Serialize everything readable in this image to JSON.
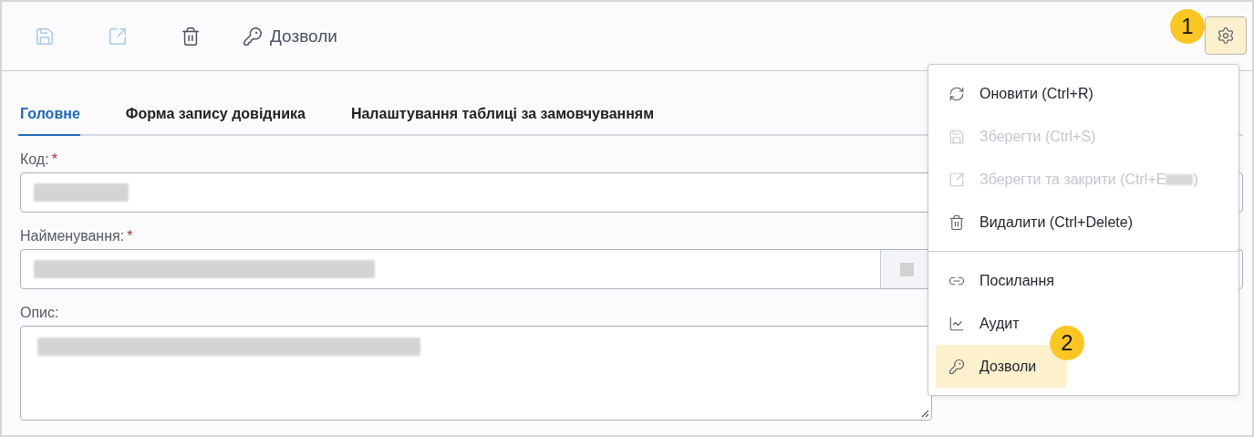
{
  "toolbar": {
    "buttons": [
      {
        "disabled": true
      },
      {
        "disabled": true
      },
      {
        "disabled": false
      },
      {
        "label": "Дозволи",
        "disabled": false
      }
    ],
    "settings": {
      "active": true,
      "callout": "1"
    }
  },
  "tabs": [
    {
      "label": "Головне",
      "selected": true
    },
    {
      "label": "Форма запису довідника",
      "selected": false
    },
    {
      "label": "Налаштування таблиці за замовчуванням",
      "selected": false
    }
  ],
  "fields": [
    {
      "kind": "input",
      "label": "Код:",
      "mark": "*",
      "redacted": true
    },
    {
      "kind": "input-addon",
      "label": "Найменування:",
      "mark": "*",
      "redacted": true
    },
    {
      "kind": "textarea",
      "label": "Опис:",
      "redacted": true
    }
  ],
  "menu": {
    "groups": [
      [
        {
          "label": "Оновити (Ctrl+R)",
          "disabled": false,
          "selected": false
        },
        {
          "label": "Зберегти (Ctrl+S)",
          "disabled": true,
          "selected": false
        },
        {
          "label": "Зберегти та закрити (Ctrl+E",
          "label_end": ")",
          "disabled": true,
          "selected": false
        },
        {
          "label": "Видалити (Ctrl+Delete)",
          "disabled": false,
          "selected": false
        }
      ],
      [
        {
          "label": "Посилання",
          "disabled": false,
          "selected": false
        },
        {
          "label": "Аудит",
          "disabled": false,
          "selected": false
        },
        {
          "label": "Дозволи",
          "disabled": false,
          "selected": true,
          "callout": "2"
        }
      ]
    ]
  }
}
